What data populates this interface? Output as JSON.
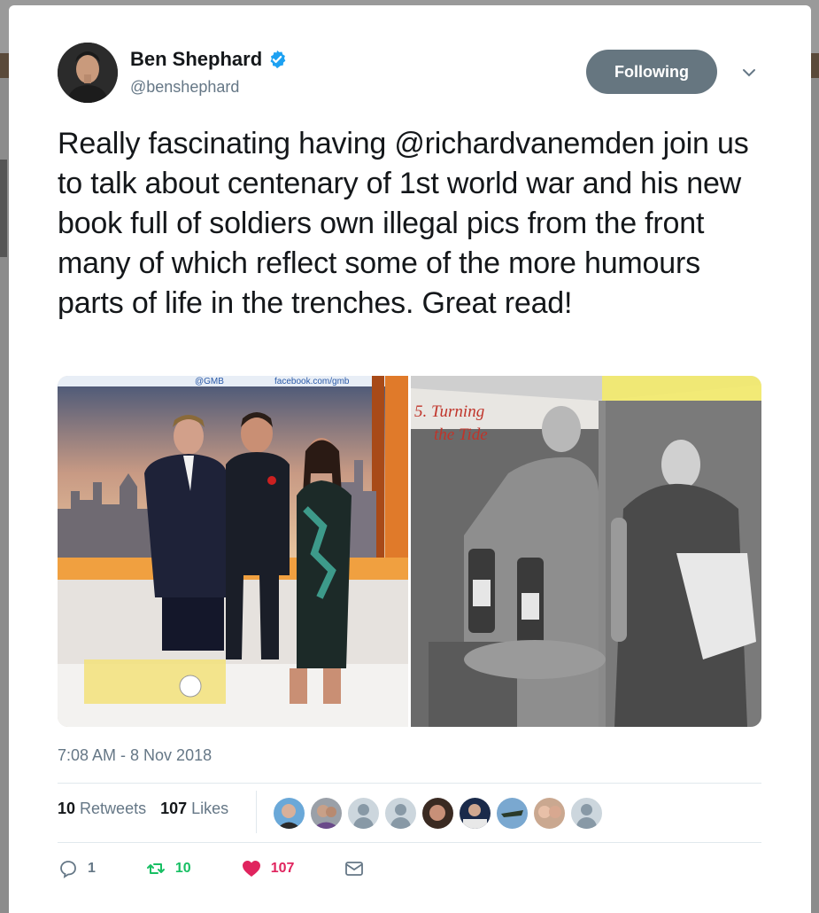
{
  "author": {
    "name": "Ben Shephard",
    "handle": "@benshephard",
    "verified": true
  },
  "follow_button": {
    "label": "Following"
  },
  "tweet": {
    "text": "Really fascinating having @richardvanemden join us to talk about centenary of 1st world war and his new book full of soldiers own illegal pics from the front many of which reflect some of the more humours parts of life in the trenches. Great read!",
    "timestamp": "7:08 AM - 8 Nov 2018"
  },
  "media": {
    "left_photo_text": {
      "handle_gmb": "@GMB",
      "facebook": "facebook.com/gmb"
    },
    "right_photo_text": {
      "chapter": "5. Turning",
      "chapter_line2": "the Tide"
    }
  },
  "stats": {
    "retweets_count": "10",
    "retweets_label": "Retweets",
    "likes_count": "107",
    "likes_label": "Likes"
  },
  "actions": {
    "reply_count": "1",
    "retweet_count": "10",
    "like_count": "107"
  },
  "colors": {
    "accent": "#1da1f2",
    "retweet_green": "#17bf63",
    "like_red": "#e0245e",
    "follow_bg": "#667680"
  }
}
